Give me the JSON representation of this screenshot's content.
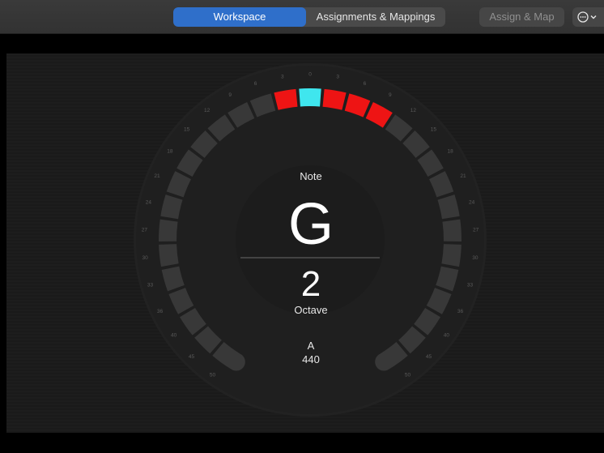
{
  "toolbar": {
    "tabs": [
      {
        "label": "Workspace",
        "selected": true
      },
      {
        "label": "Assignments & Mappings",
        "selected": false
      }
    ],
    "assign_map_label": "Assign & Map",
    "more_icon": "ellipsis-circle-icon",
    "more_chevron_icon": "chevron-down-icon"
  },
  "tuner": {
    "note_label": "Note",
    "note": "G",
    "octave": "2",
    "octave_label": "Octave",
    "reference_note": "A",
    "reference_freq": "440",
    "cent_scale_left": [
      "3",
      "6",
      "9",
      "12",
      "15",
      "18",
      "21",
      "24",
      "27",
      "30",
      "33",
      "36",
      "40",
      "45",
      "50"
    ],
    "cent_scale_center": "0",
    "cent_scale_right": [
      "3",
      "6",
      "9",
      "12",
      "15",
      "18",
      "21",
      "24",
      "27",
      "30",
      "33",
      "36",
      "40",
      "45",
      "50"
    ],
    "active_segments": {
      "center": "0",
      "left": [
        "3"
      ],
      "right": [
        "3",
        "6",
        "9"
      ]
    },
    "colors": {
      "in_tune": "#3fe6ee",
      "off": "#ee1414",
      "inactive": "#383838",
      "accent": "#2f6fca"
    }
  }
}
